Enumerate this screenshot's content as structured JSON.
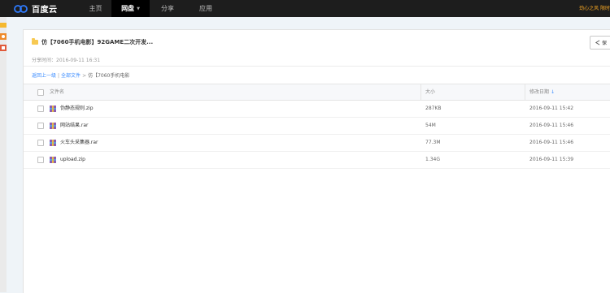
{
  "topbar": {
    "logo_text": "百度云",
    "nav": [
      "主页",
      "网盘",
      "分享",
      "应用"
    ],
    "user_text": "劲心之风  限时"
  },
  "share": {
    "title": "仿【7060手机电影】92GAME二次开发...",
    "time": "分享时间：2016-09-11 16:31",
    "save_label": "保"
  },
  "breadcrumb": {
    "back": "返回上一级",
    "all_files": "全部文件",
    "current": "仿【7060手机电影"
  },
  "table": {
    "headers": [
      "文件名",
      "大小",
      "修改日期"
    ],
    "sort_arrow": "↓",
    "rows": [
      {
        "name": "伪静态规则.zip",
        "size": "287KB",
        "date": "2016-09-11 15:42"
      },
      {
        "name": "网站结果.rar",
        "size": "54M",
        "date": "2016-09-11 15:46"
      },
      {
        "name": "火车头采集器.rar",
        "size": "77.3M",
        "date": "2016-09-11 15:46"
      },
      {
        "name": "upload.zip",
        "size": "1.34G",
        "date": "2016-09-11 15:39"
      }
    ]
  },
  "icons": {
    "logo": "cloud-logo-icon",
    "folder": "folder-icon",
    "archive": "archive-file-icon",
    "save": "save-icon"
  },
  "colors": {
    "topbar": "#1d1d1d",
    "link": "#3b8cff",
    "user": "#f5a623",
    "folder": "#f7c952"
  }
}
